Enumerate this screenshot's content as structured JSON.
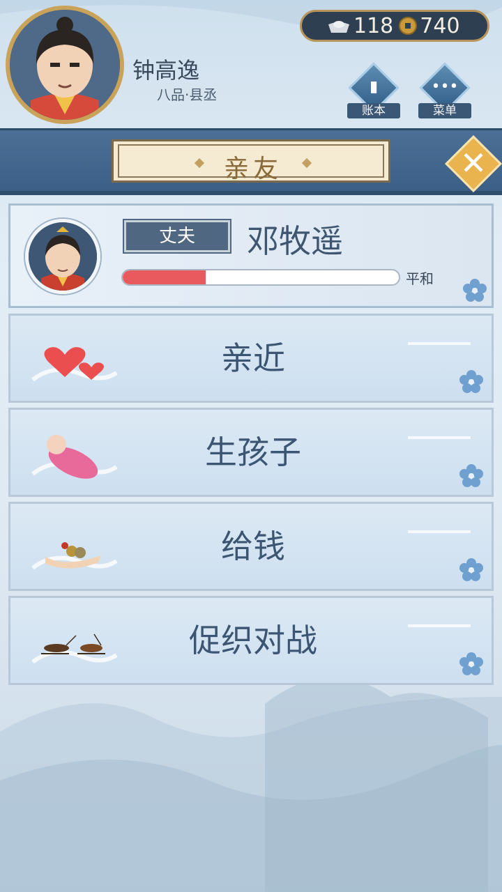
{
  "player": {
    "name": "钟高逸",
    "rank": "八品·县丞"
  },
  "currency": {
    "silver": "118",
    "copper": "740"
  },
  "buttons": {
    "ledger": "账本",
    "menu": "菜单"
  },
  "title": "亲友",
  "spouse": {
    "role": "丈夫",
    "name": "邓牧遥",
    "mood_label": "平和",
    "mood_fraction": 0.3
  },
  "actions": [
    {
      "label": "亲近",
      "icon": "hearts-icon"
    },
    {
      "label": "生孩子",
      "icon": "baby-icon"
    },
    {
      "label": "给钱",
      "icon": "coins-hand-icon"
    },
    {
      "label": "促织对战",
      "icon": "crickets-icon"
    }
  ],
  "colors": {
    "accent": "#e85a5e",
    "panel": "#3b5f86",
    "gold": "#e9b44d"
  }
}
